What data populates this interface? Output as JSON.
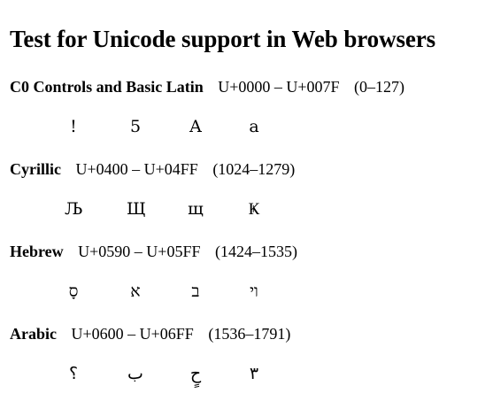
{
  "page": {
    "title": "Test for Unicode support in Web browsers"
  },
  "sections": [
    {
      "name": "C0 Controls and Basic Latin",
      "range": "U+0000 – U+007F",
      "decimal": "(0–127)",
      "chars": [
        "!",
        "5",
        "A",
        "a"
      ]
    },
    {
      "name": "Cyrillic",
      "range": "U+0400 – U+04FF",
      "decimal": "(1024–1279)",
      "chars": [
        "Љ",
        "Щ",
        "щ",
        "Ҝ"
      ]
    },
    {
      "name": "Hebrew",
      "range": "U+0590 – U+05FF",
      "decimal": "(1424–1535)",
      "chars": [
        "סָ",
        "א",
        "ב",
        "וי"
      ]
    },
    {
      "name": "Arabic",
      "range": "U+0600 – U+06FF",
      "decimal": "(1536–1791)",
      "chars": [
        "؟",
        "ب",
        "حٍ",
        "٣"
      ]
    }
  ]
}
